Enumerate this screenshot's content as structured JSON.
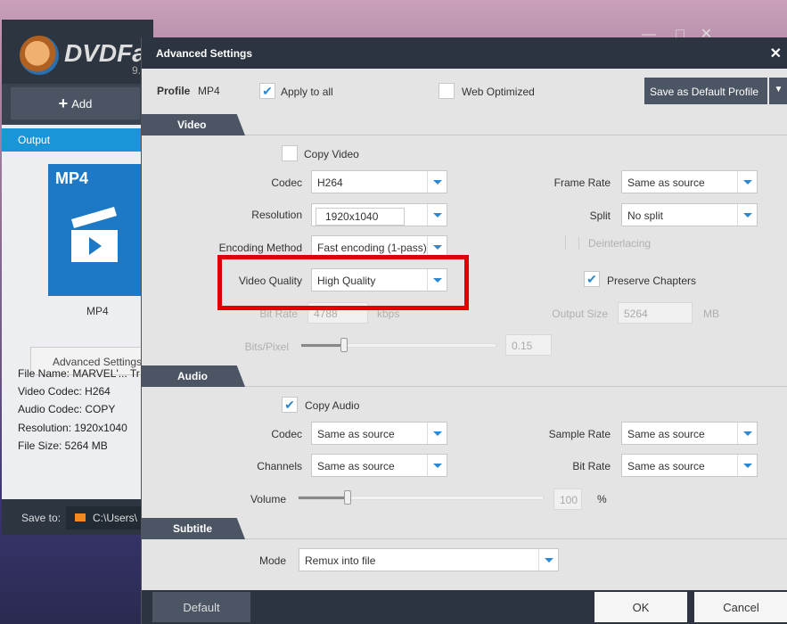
{
  "app": {
    "brand": "DVDFab",
    "version": "9.",
    "add_label": "Add",
    "output_tab": "Output",
    "format_badge": "MP4",
    "format_name": "MP4",
    "advanced_settings": "Advanced Settings",
    "info": [
      "File Name: MARVEL'... Tr",
      "Video Codec: H264",
      "Audio Codec: COPY",
      "Resolution: 1920x1040",
      "File Size: 5264 MB"
    ],
    "save_to_label": "Save to:",
    "save_path": "C:\\Users\\"
  },
  "dialog": {
    "title": "Advanced Settings",
    "profile_label": "Profile",
    "profile_value": "MP4",
    "apply_to_all": "Apply to all",
    "web_optimized": "Web Optimized",
    "save_default": "Save as Default Profile",
    "video": {
      "section": "Video",
      "copy_video": "Copy Video",
      "codec_label": "Codec",
      "codec": "H264",
      "resolution_label": "Resolution",
      "resolution": "1920x1040",
      "encoding_label": "Encoding Method",
      "encoding": "Fast encoding (1-pass)",
      "quality_label": "Video Quality",
      "quality": "High Quality",
      "bitrate_label": "Bit Rate",
      "bitrate": "4788",
      "bitrate_unit": "kbps",
      "bpp_label": "Bits/Pixel",
      "bpp": "0.15",
      "bpp_fraction": 0.22,
      "framerate_label": "Frame Rate",
      "framerate": "Same as source",
      "split_label": "Split",
      "split": "No split",
      "deinterlacing": "Deinterlacing",
      "preserve_chapters": "Preserve Chapters",
      "outsize_label": "Output Size",
      "outsize": "5264",
      "outsize_unit": "MB"
    },
    "audio": {
      "section": "Audio",
      "copy_audio": "Copy Audio",
      "codec_label": "Codec",
      "codec": "Same as source",
      "channels_label": "Channels",
      "channels": "Same as source",
      "volume_label": "Volume",
      "volume": "100",
      "volume_unit": "%",
      "volume_fraction": 0.2,
      "samplerate_label": "Sample Rate",
      "samplerate": "Same as source",
      "bitrate_label": "Bit Rate",
      "bitrate": "Same as source"
    },
    "subtitle": {
      "section": "Subtitle",
      "mode_label": "Mode",
      "mode": "Remux into file"
    },
    "default_btn": "Default",
    "ok_btn": "OK",
    "cancel_btn": "Cancel"
  },
  "accent": "#2d88d0",
  "highlight": "#e00000"
}
